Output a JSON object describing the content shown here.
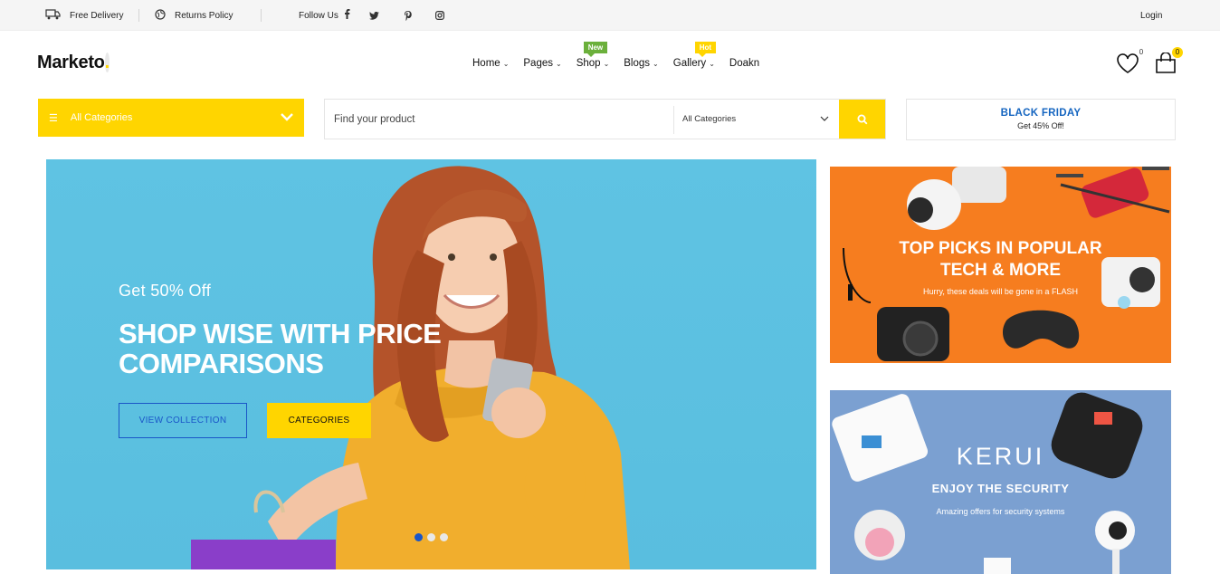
{
  "topbar": {
    "delivery": "Free Delivery",
    "returns": "Returns Policy",
    "follow": "Follow Us",
    "social": [
      "twitter-icon",
      "pinterest-icon",
      "instagram-icon"
    ],
    "login": "Login"
  },
  "header": {
    "logo": "Marketo",
    "logo_dot": ".",
    "nav": [
      {
        "label": "Home"
      },
      {
        "label": "Pages"
      },
      {
        "label": "Shop",
        "badge": "New"
      },
      {
        "label": "Blogs"
      },
      {
        "label": "Gallery",
        "badge": "Hot"
      },
      {
        "label": "Doakn"
      }
    ],
    "wishlist_count": "0",
    "cart_count": "0"
  },
  "search": {
    "categories_label": "All Categories",
    "placeholder": "Find your product",
    "category_select": "All Categories"
  },
  "promo": {
    "title": "BLACK FRIDAY",
    "subtitle": "Get 45% Off!"
  },
  "hero": {
    "subtitle": "Get 50% Off",
    "title": "SHOP WISE WITH PRICE COMPARISONS",
    "primary_button": "VIEW COLLECTION",
    "secondary_button": "CATEGORIES",
    "slides": 3,
    "active_slide": 1
  },
  "banner1": {
    "title_line1": "TOP PICKS IN POPULAR",
    "title_line2": "TECH & MORE",
    "subtitle": "Hurry, these deals will be gone in a FLASH"
  },
  "banner2": {
    "brand": "KERUI",
    "title": "ENJOY THE SECURITY",
    "subtitle": "Amazing offers for security systems"
  },
  "colors": {
    "accent": "#ffd500",
    "blue": "#1a56c8",
    "hero_bg": "#5fc3e3",
    "banner_orange": "#f67d1f",
    "banner_blue": "#7ba0d1"
  }
}
